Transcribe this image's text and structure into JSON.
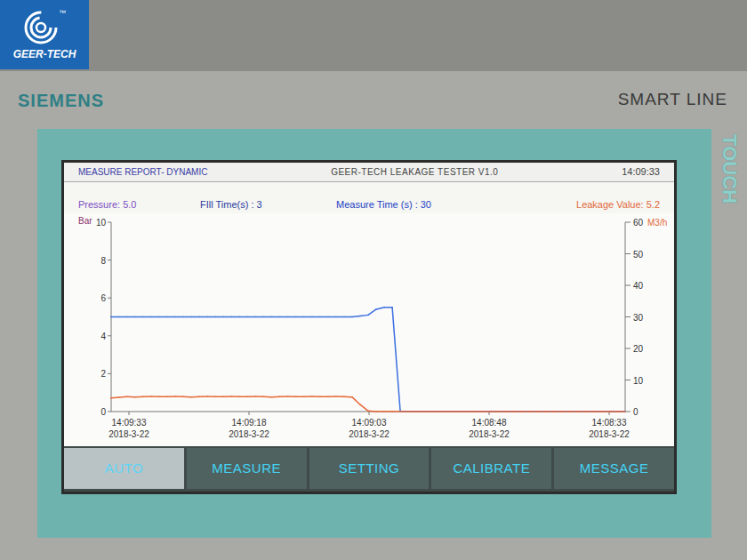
{
  "logo": {
    "text": "GEER-TECH",
    "tm": "™"
  },
  "bezel": {
    "brand": "SIEMENS",
    "model": "SMART LINE",
    "touch": "TOUCH"
  },
  "header": {
    "title": "MEASURE REPORT- DYNAMIC",
    "app": "GEER-TECH  LEAKAGE  TESTER  V1.0",
    "time": "14:09:33"
  },
  "readings": [
    {
      "text": "Pressure: 5.0",
      "color": "#7a4fc2"
    },
    {
      "text": "FIll Time(s) : 3",
      "color": "#2a3d9e"
    },
    {
      "text": "Measure Time (s) : 30",
      "color": "#2342c4"
    },
    {
      "text": "Leakage Value: 5.2",
      "color": "#e2693a"
    }
  ],
  "chart": {
    "left_axis": {
      "unit": "Bar",
      "ticks": [
        "10",
        "8",
        "6",
        "4",
        "2",
        "0"
      ]
    },
    "right_axis": {
      "unit": "M3/h",
      "ticks": [
        "60",
        "50",
        "40",
        "30",
        "20",
        "10",
        "0"
      ]
    },
    "x_ticks": [
      {
        "time": "14:09:33",
        "date": "2018-3-22"
      },
      {
        "time": "14:09:18",
        "date": "2018-3-22"
      },
      {
        "time": "14:09:03",
        "date": "2018-3-22"
      },
      {
        "time": "14:08:48",
        "date": "2018-3-22"
      },
      {
        "time": "14:08:33",
        "date": "2018-3-22"
      }
    ],
    "series": [
      {
        "axis": "left",
        "color": "#3b6fe0",
        "values": [
          5.0,
          5.0,
          5.0,
          5.0,
          5.0,
          5.0,
          5.0,
          5.0,
          5.0,
          5.0,
          5.0,
          5.0,
          5.0,
          5.0,
          5.0,
          5.0,
          5.0,
          5.0,
          5.0,
          5.0,
          5.0,
          5.0,
          5.0,
          5.0,
          5.0,
          5.0,
          5.0,
          5.0,
          5.0,
          5.0,
          5.0,
          5.05,
          5.1,
          5.4,
          5.5,
          5.5,
          0,
          0,
          0,
          0,
          0,
          0,
          0,
          0,
          0,
          0,
          0,
          0,
          0,
          0,
          0,
          0,
          0,
          0,
          0,
          0,
          0,
          0,
          0,
          0,
          0,
          0,
          0,
          0,
          0
        ]
      },
      {
        "axis": "right",
        "color": "#e8683a",
        "values": [
          4.3,
          4.5,
          4.7,
          4.6,
          4.7,
          4.8,
          4.7,
          4.7,
          4.8,
          4.7,
          4.6,
          4.7,
          4.8,
          4.7,
          4.7,
          4.8,
          4.7,
          4.7,
          4.8,
          4.7,
          4.6,
          4.7,
          4.8,
          4.7,
          4.7,
          4.8,
          4.7,
          4.7,
          4.8,
          4.7,
          4.6,
          2.2,
          0.2,
          0,
          0,
          0,
          0,
          0,
          0,
          0,
          0,
          0,
          0,
          0,
          0,
          0,
          0,
          0,
          0,
          0,
          0,
          0,
          0,
          0,
          0,
          0,
          0,
          0,
          0,
          0,
          0,
          0,
          0,
          0,
          0
        ]
      }
    ]
  },
  "buttons": [
    {
      "label": "AUTO",
      "selected": true
    },
    {
      "label": "MEASURE",
      "selected": false
    },
    {
      "label": "SETTING",
      "selected": false
    },
    {
      "label": "CALIBRATE",
      "selected": false
    },
    {
      "label": "MESSAGE",
      "selected": false
    }
  ]
}
